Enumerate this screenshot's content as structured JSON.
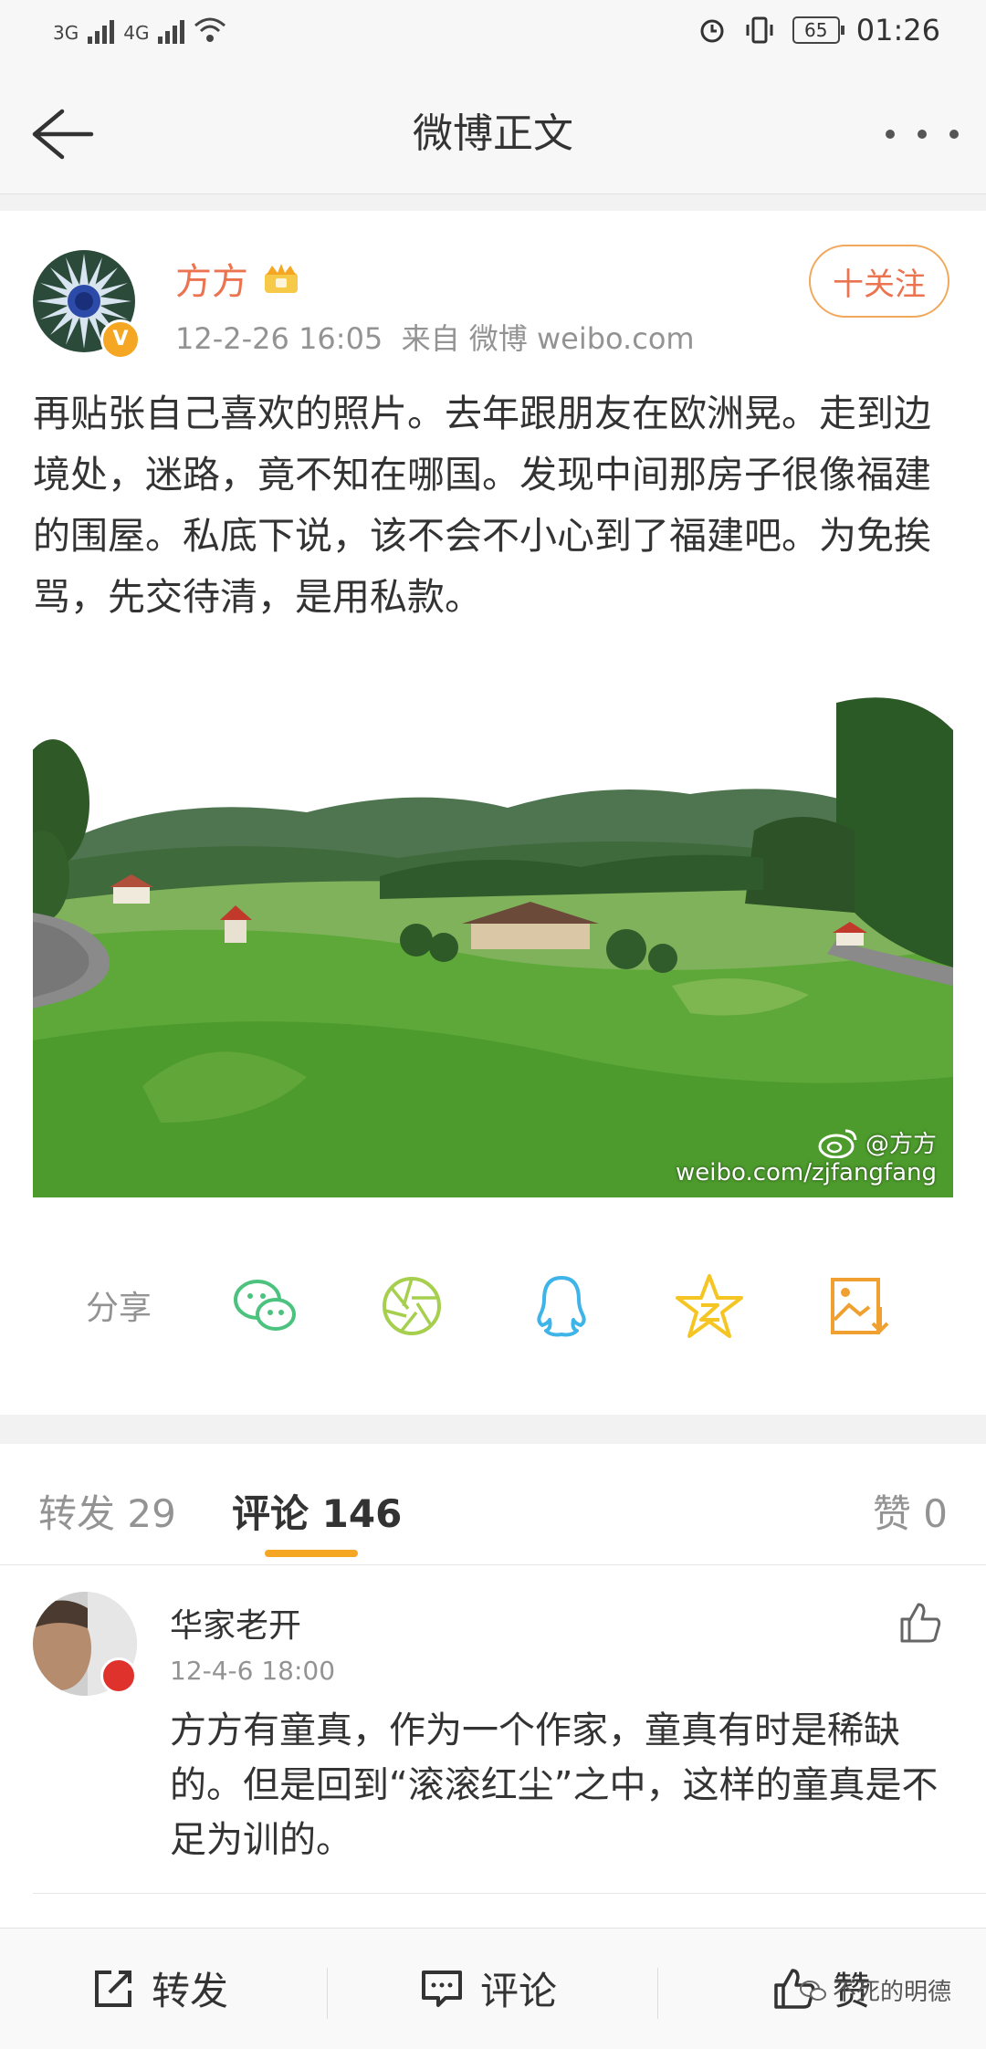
{
  "status_bar": {
    "network1": "3G",
    "network2": "4G",
    "battery": "65",
    "time": "01:26"
  },
  "nav": {
    "title": "微博正文",
    "back_icon": "back-arrow-icon",
    "more_icon": "more-dots-icon"
  },
  "post": {
    "author": "方方",
    "verified_badge": "V",
    "meta": "12-2-26 16:05  来自 微博 weibo.com",
    "follow_label": "十关注",
    "text": "再贴张自己喜欢的照片。去年跟朋友在欧洲晃。走到边境处，迷路，竟不知在哪国。发现中间那房子很像福建的围屋。私底下说，该不会不小心到了福建吧。为免挨骂，先交待清，是用私款。",
    "photo_watermark_user": "@方方",
    "photo_watermark_url": "weibo.com/zjfangfang"
  },
  "share": {
    "label": "分享",
    "icons": [
      "wechat-icon",
      "moments-icon",
      "qq-icon",
      "qzone-star-icon",
      "save-image-icon"
    ]
  },
  "tabs": {
    "repost": "转发 29",
    "comments": "评论 146",
    "likes": "赞 0"
  },
  "comment": {
    "name": "华家老开",
    "date": "12-4-6 18:00",
    "text": "方方有童真，作为一个作家，童真有时是稀缺的。但是回到“滚滚红尘”之中，这样的童真是不足为训的。"
  },
  "bottom_bar": {
    "repost": "转发",
    "comment": "评论",
    "like": "赞",
    "watermark": "不死的明德"
  },
  "colors": {
    "accent_orange": "#eb7350",
    "tab_indicator": "#f5a623",
    "wechat_green": "#4bc27d",
    "moments_green": "#a6cf4e",
    "qq_blue": "#3fb4e8",
    "qzone_yellow": "#f5c623",
    "save_orange": "#f0a030"
  }
}
